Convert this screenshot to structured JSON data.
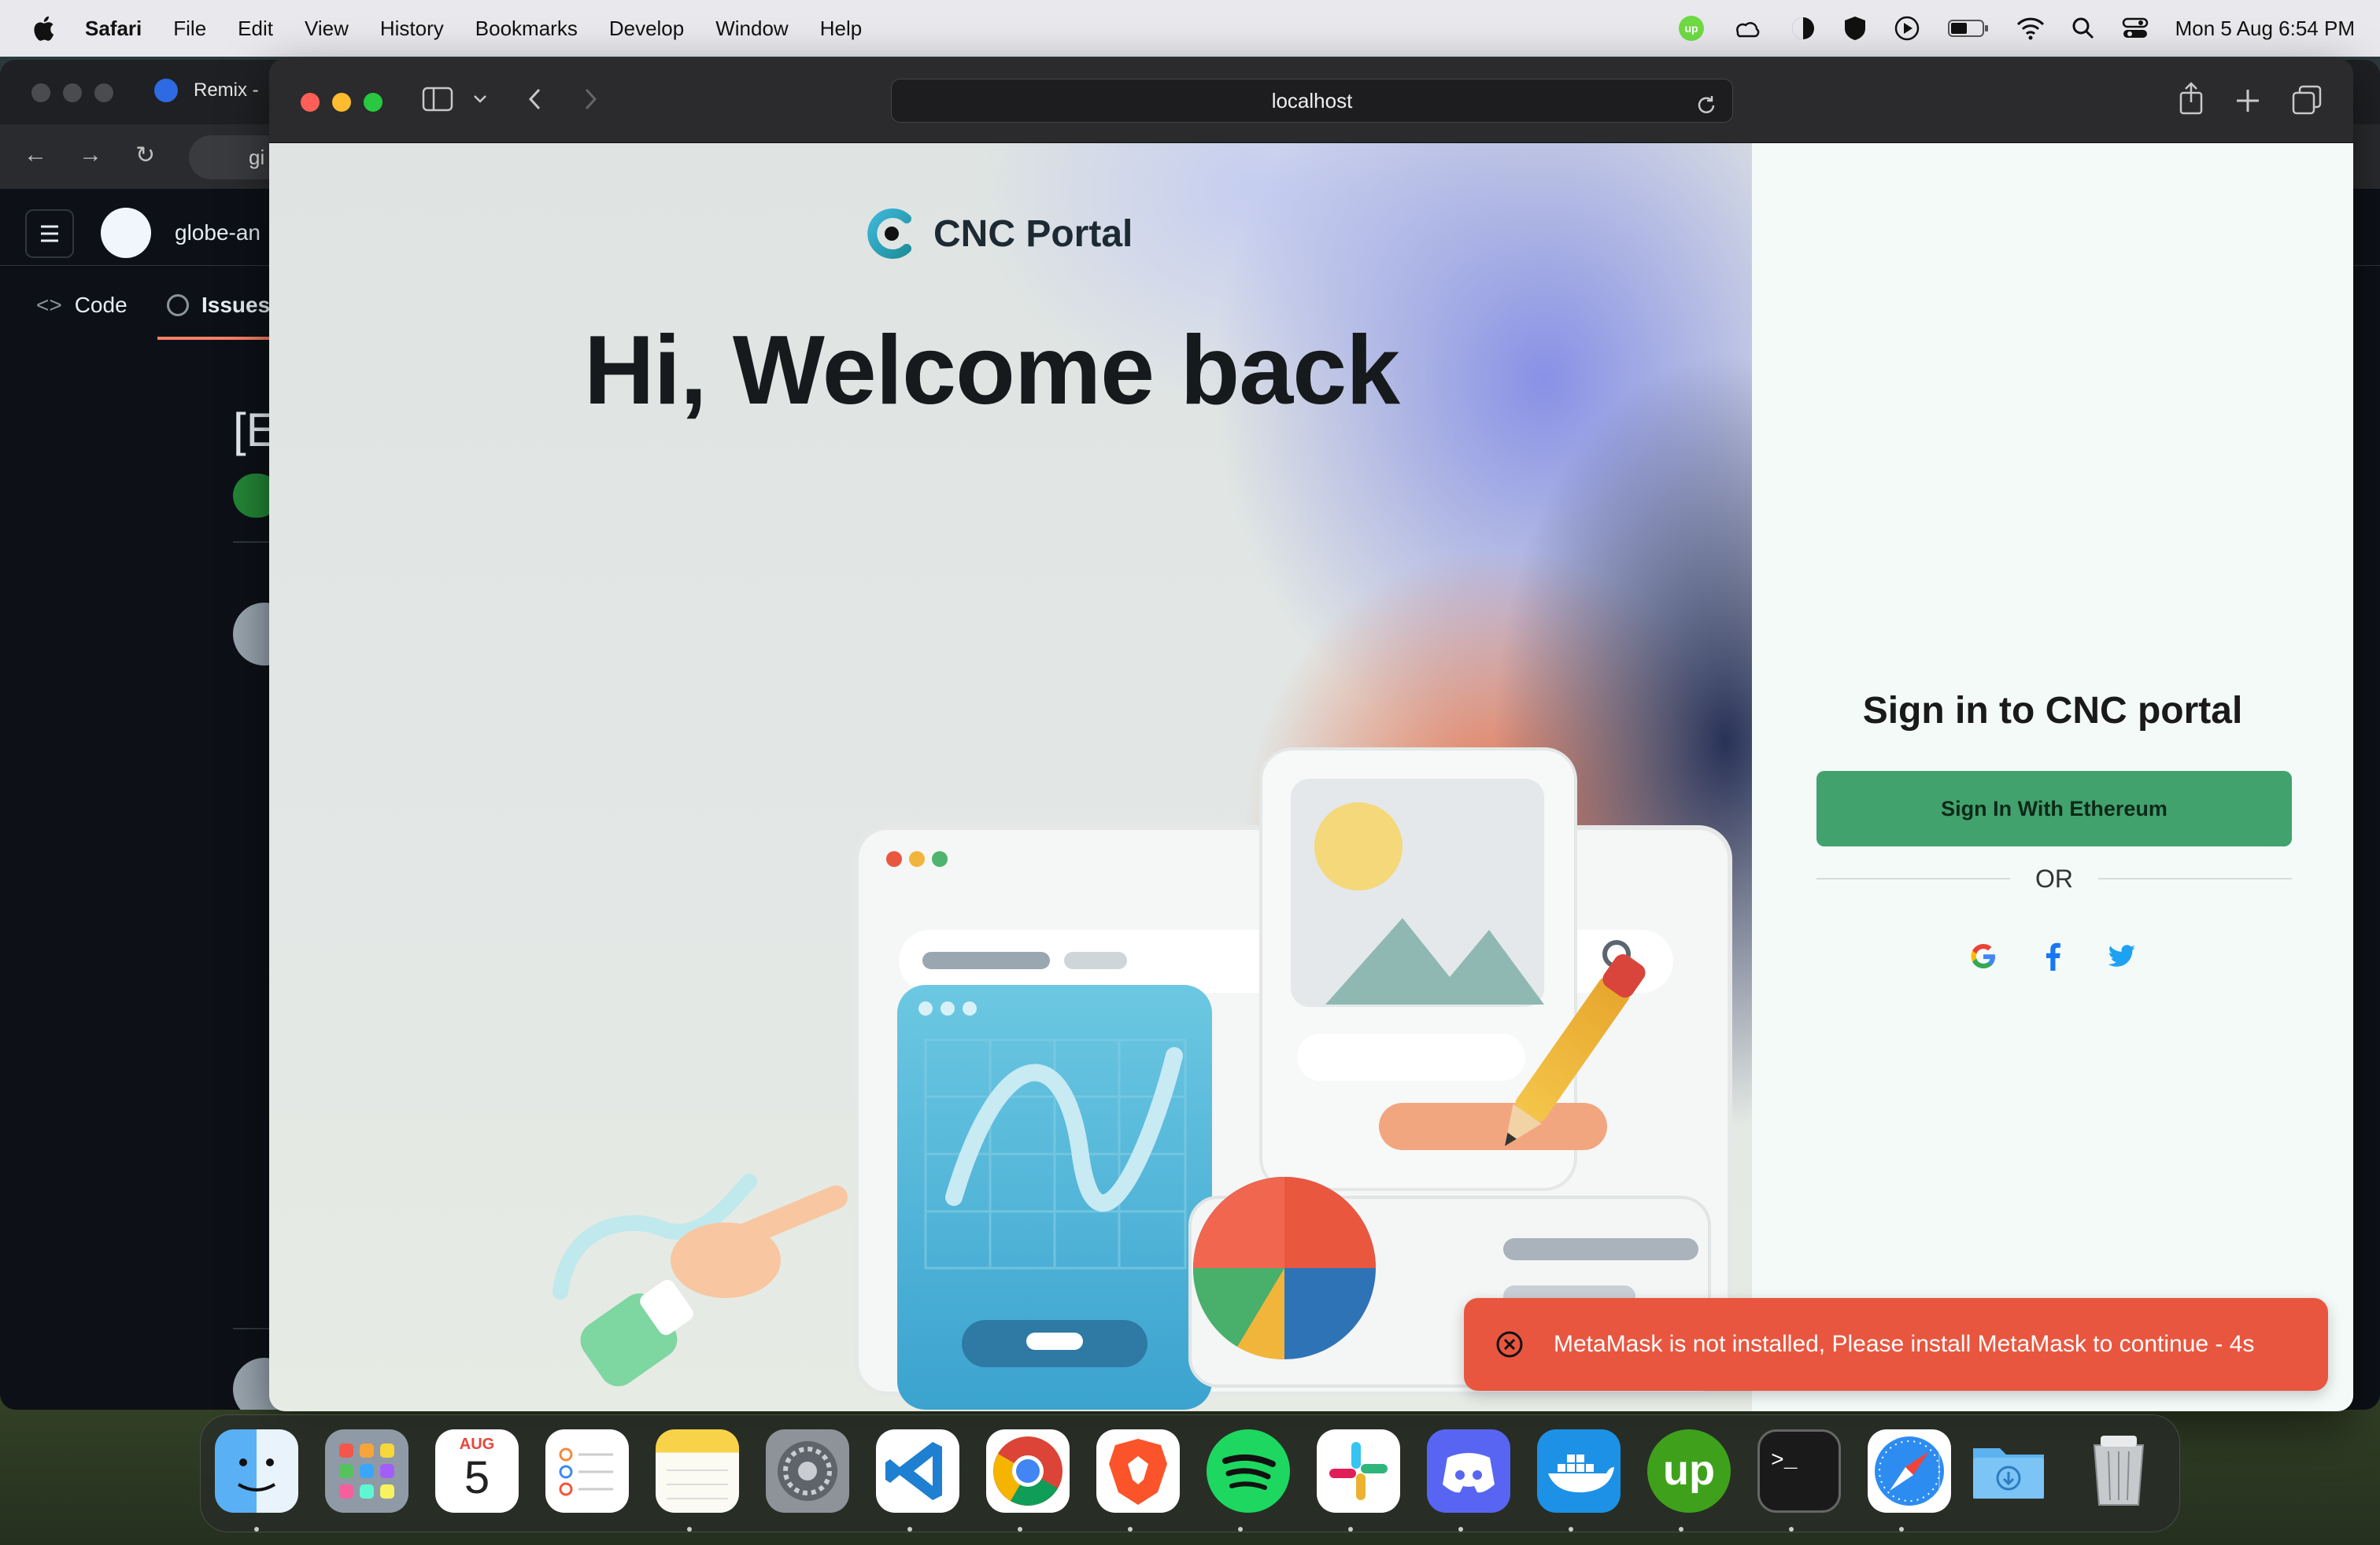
{
  "menubar": {
    "app_name": "Safari",
    "items": [
      "File",
      "Edit",
      "View",
      "History",
      "Bookmarks",
      "Develop",
      "Window",
      "Help"
    ],
    "clock": "Mon 5 Aug  6:54 PM",
    "status_icons": [
      "upwork-icon",
      "weather-icon",
      "dark-mode-icon",
      "vpn-icon",
      "play-icon",
      "battery-icon",
      "wifi-icon",
      "search-icon",
      "control-center-icon"
    ]
  },
  "background_browser": {
    "tab_title": "Remix -",
    "url_fragment": "gi",
    "repo_fragment": "globe-an",
    "tab_code": "Code",
    "tab_issues": "Issues",
    "heading_fragment": "[E"
  },
  "safari": {
    "address": "localhost"
  },
  "page": {
    "brand": "CNC Portal",
    "welcome": "Hi, Welcome back",
    "signin_title": "Sign in to CNC portal",
    "eth_button": "Sign In With Ethereum",
    "divider_text": "OR",
    "socials": [
      "google-icon",
      "facebook-icon",
      "twitter-icon"
    ]
  },
  "toast": {
    "message": "MetaMask is not installed, Please install MetaMask to continue - 4s",
    "color": "#e9563f"
  },
  "dock": {
    "calendar_month": "AUG",
    "calendar_day": "5",
    "apps": [
      "finder",
      "launchpad",
      "calendar",
      "reminders",
      "notes",
      "system-settings",
      "vscode",
      "chrome",
      "brave",
      "spotify",
      "slack",
      "discord",
      "docker",
      "upwork",
      "terminal",
      "safari",
      "downloads",
      "trash"
    ]
  },
  "colors": {
    "accent_green": "#41a26d",
    "toast_red": "#e9563f"
  }
}
